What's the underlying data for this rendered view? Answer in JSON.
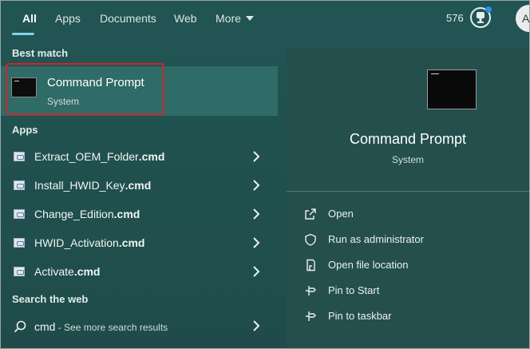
{
  "tabs": [
    {
      "label": "All",
      "active": true
    },
    {
      "label": "Apps"
    },
    {
      "label": "Documents"
    },
    {
      "label": "Web"
    },
    {
      "label": "More"
    }
  ],
  "header": {
    "points": "576",
    "avatar_letter": "A"
  },
  "sections": {
    "best_match": "Best match",
    "apps": "Apps",
    "web": "Search the web"
  },
  "best_match": {
    "title": "Command Prompt",
    "subtitle": "System"
  },
  "apps": [
    {
      "stem": "Extract_OEM_Folder",
      "ext": ".cmd"
    },
    {
      "stem": "Install_HWID_Key",
      "ext": ".cmd"
    },
    {
      "stem": "Change_Edition",
      "ext": ".cmd"
    },
    {
      "stem": "HWID_Activation",
      "ext": ".cmd"
    },
    {
      "stem": "Activate",
      "ext": ".cmd"
    }
  ],
  "web_search": {
    "query": "cmd",
    "hint": " - See more search results"
  },
  "detail": {
    "title": "Command Prompt",
    "subtitle": "System",
    "actions": [
      "Open",
      "Run as administrator",
      "Open file location",
      "Pin to Start",
      "Pin to taskbar"
    ]
  },
  "colors": {
    "highlight_border": "#d4242a",
    "accent": "#7fd4e6",
    "selected_bg": "#2f6b67"
  }
}
